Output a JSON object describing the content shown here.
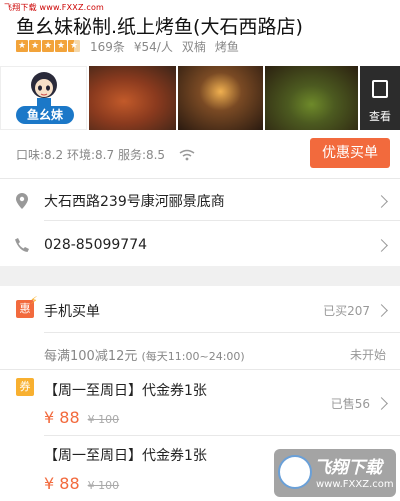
{
  "watermark_top": "飞翔下载 www.FXXZ.com",
  "store": {
    "title": "鱼幺妹秘制.纸上烤鱼(大石西路店)",
    "reviews": "169条",
    "avg_price": "¥54/人",
    "area": "双楠",
    "category": "烤鱼",
    "rating_stars": 4.5,
    "logo_text": "鱼幺妹",
    "view_all": "查看"
  },
  "scores": {
    "taste": "口味:8.2",
    "environment": "环境:8.7",
    "service": "服务:8.5"
  },
  "buy_button": "优惠买单",
  "address": "大石西路239号康河郦景底商",
  "phone": "028-85099774",
  "mobile_pay": {
    "badge": "惠",
    "title": "手机买单",
    "bought": "已买207",
    "promo": "每满100减12元",
    "promo_time": "(每天11:00~24:00)",
    "status": "未开始"
  },
  "deals": {
    "badge": "券",
    "sold": "已售56",
    "items": [
      {
        "title": "【周一至周日】代金券1张",
        "price": "¥ 88",
        "original": "¥ 100"
      },
      {
        "title": "【周一至周日】代金券1张",
        "price": "¥ 88",
        "original": "¥ 100"
      }
    ]
  },
  "watermark": {
    "title": "飞翔下载",
    "url": "www.FXXZ.com"
  },
  "colors": {
    "accent": "#f26a3d",
    "star": "#f2a33a",
    "coupon": "#f8b030"
  }
}
